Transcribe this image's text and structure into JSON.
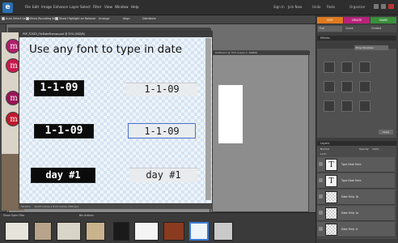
{
  "menubar": {
    "items": [
      "File",
      "Edit",
      "Image",
      "Enhance",
      "Layer",
      "Select",
      "Filter",
      "View",
      "Window",
      "Help"
    ],
    "sign_in": "Sign In",
    "join_now": "Join Now",
    "undo": "Undo",
    "redo": "Redo",
    "organizer": "Organizer"
  },
  "optionbar": {
    "auto_select": "Auto Select Layer",
    "show_bbox": "Show Bounding Box",
    "show_highlight": "Show Highlight on Rollover",
    "arrange": "Arrange",
    "align": "Align",
    "distribute": "Distribute"
  },
  "document": {
    "title": "PSP_FDSE5_FileDateStamps.psd @ 50% (RGB/8)",
    "headline": "Use any font to type in date",
    "stamps": [
      {
        "text": "1-1-09",
        "style": "dark"
      },
      {
        "text": "1-1-09",
        "style": "light"
      },
      {
        "text": "1-1-09",
        "style": "dark"
      },
      {
        "text": "1-1-09",
        "style": "light"
      },
      {
        "text": "day #1",
        "style": "dark"
      },
      {
        "text": "day #1",
        "style": "light"
      }
    ],
    "status": "50.01%",
    "status_dims": "10.03 inches x 8.03 inches (300 ppi)"
  },
  "doc3": {
    "title": "Untitled-1 @ 33% (Layer 1, RGB/8)"
  },
  "panel": {
    "modes": [
      "EDIT",
      "CREATE",
      "SHARE"
    ],
    "subtabs": [
      "Full",
      "Quick",
      "Guided"
    ],
    "effects_header": "Effects",
    "effects_dropdown": "Drop Shadows",
    "apply": "Apply",
    "layers_header": "Layers",
    "normal": "Normal",
    "opacity_label": "Opacity:",
    "opacity_value": "100%",
    "lock_label": "Lock:",
    "layers": [
      {
        "name": "Type Date Here",
        "kind": "text"
      },
      {
        "name": "Type Date Here",
        "kind": "text"
      },
      {
        "name": "Date Strip 1b",
        "kind": "pixel"
      },
      {
        "name": "Date Strip 1a",
        "kind": "pixel"
      },
      {
        "name": "Date Strip 1c",
        "kind": "pixel"
      },
      {
        "name": "Type Date Here",
        "kind": "text"
      }
    ]
  },
  "bin": {
    "show_open_files": "Show Open Files",
    "bin_actions": "Bin Actions"
  },
  "colors": {
    "edit_tab": "#e07a1f",
    "create_tab": "#b8237a",
    "share_tab": "#3a8f3a",
    "bead_colors": [
      "#b01e6a",
      "#c9184a",
      "#9a1257",
      "#c0192c"
    ]
  }
}
